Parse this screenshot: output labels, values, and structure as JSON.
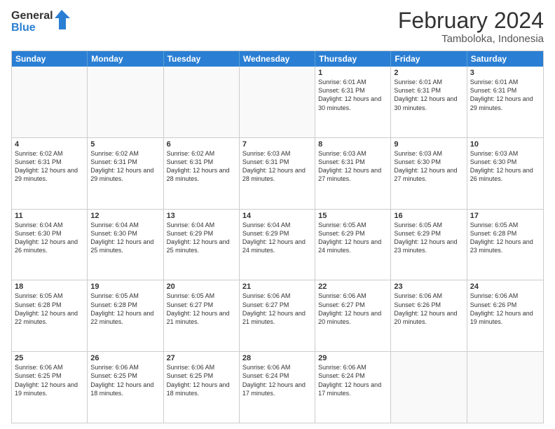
{
  "logo": {
    "line1": "General",
    "line2": "Blue"
  },
  "title": "February 2024",
  "subtitle": "Tamboloka, Indonesia",
  "header_days": [
    "Sunday",
    "Monday",
    "Tuesday",
    "Wednesday",
    "Thursday",
    "Friday",
    "Saturday"
  ],
  "weeks": [
    [
      {
        "day": "",
        "sunrise": "",
        "sunset": "",
        "daylight": ""
      },
      {
        "day": "",
        "sunrise": "",
        "sunset": "",
        "daylight": ""
      },
      {
        "day": "",
        "sunrise": "",
        "sunset": "",
        "daylight": ""
      },
      {
        "day": "",
        "sunrise": "",
        "sunset": "",
        "daylight": ""
      },
      {
        "day": "1",
        "sunrise": "Sunrise: 6:01 AM",
        "sunset": "Sunset: 6:31 PM",
        "daylight": "Daylight: 12 hours and 30 minutes."
      },
      {
        "day": "2",
        "sunrise": "Sunrise: 6:01 AM",
        "sunset": "Sunset: 6:31 PM",
        "daylight": "Daylight: 12 hours and 30 minutes."
      },
      {
        "day": "3",
        "sunrise": "Sunrise: 6:01 AM",
        "sunset": "Sunset: 6:31 PM",
        "daylight": "Daylight: 12 hours and 29 minutes."
      }
    ],
    [
      {
        "day": "4",
        "sunrise": "Sunrise: 6:02 AM",
        "sunset": "Sunset: 6:31 PM",
        "daylight": "Daylight: 12 hours and 29 minutes."
      },
      {
        "day": "5",
        "sunrise": "Sunrise: 6:02 AM",
        "sunset": "Sunset: 6:31 PM",
        "daylight": "Daylight: 12 hours and 29 minutes."
      },
      {
        "day": "6",
        "sunrise": "Sunrise: 6:02 AM",
        "sunset": "Sunset: 6:31 PM",
        "daylight": "Daylight: 12 hours and 28 minutes."
      },
      {
        "day": "7",
        "sunrise": "Sunrise: 6:03 AM",
        "sunset": "Sunset: 6:31 PM",
        "daylight": "Daylight: 12 hours and 28 minutes."
      },
      {
        "day": "8",
        "sunrise": "Sunrise: 6:03 AM",
        "sunset": "Sunset: 6:31 PM",
        "daylight": "Daylight: 12 hours and 27 minutes."
      },
      {
        "day": "9",
        "sunrise": "Sunrise: 6:03 AM",
        "sunset": "Sunset: 6:30 PM",
        "daylight": "Daylight: 12 hours and 27 minutes."
      },
      {
        "day": "10",
        "sunrise": "Sunrise: 6:03 AM",
        "sunset": "Sunset: 6:30 PM",
        "daylight": "Daylight: 12 hours and 26 minutes."
      }
    ],
    [
      {
        "day": "11",
        "sunrise": "Sunrise: 6:04 AM",
        "sunset": "Sunset: 6:30 PM",
        "daylight": "Daylight: 12 hours and 26 minutes."
      },
      {
        "day": "12",
        "sunrise": "Sunrise: 6:04 AM",
        "sunset": "Sunset: 6:30 PM",
        "daylight": "Daylight: 12 hours and 25 minutes."
      },
      {
        "day": "13",
        "sunrise": "Sunrise: 6:04 AM",
        "sunset": "Sunset: 6:29 PM",
        "daylight": "Daylight: 12 hours and 25 minutes."
      },
      {
        "day": "14",
        "sunrise": "Sunrise: 6:04 AM",
        "sunset": "Sunset: 6:29 PM",
        "daylight": "Daylight: 12 hours and 24 minutes."
      },
      {
        "day": "15",
        "sunrise": "Sunrise: 6:05 AM",
        "sunset": "Sunset: 6:29 PM",
        "daylight": "Daylight: 12 hours and 24 minutes."
      },
      {
        "day": "16",
        "sunrise": "Sunrise: 6:05 AM",
        "sunset": "Sunset: 6:29 PM",
        "daylight": "Daylight: 12 hours and 23 minutes."
      },
      {
        "day": "17",
        "sunrise": "Sunrise: 6:05 AM",
        "sunset": "Sunset: 6:28 PM",
        "daylight": "Daylight: 12 hours and 23 minutes."
      }
    ],
    [
      {
        "day": "18",
        "sunrise": "Sunrise: 6:05 AM",
        "sunset": "Sunset: 6:28 PM",
        "daylight": "Daylight: 12 hours and 22 minutes."
      },
      {
        "day": "19",
        "sunrise": "Sunrise: 6:05 AM",
        "sunset": "Sunset: 6:28 PM",
        "daylight": "Daylight: 12 hours and 22 minutes."
      },
      {
        "day": "20",
        "sunrise": "Sunrise: 6:05 AM",
        "sunset": "Sunset: 6:27 PM",
        "daylight": "Daylight: 12 hours and 21 minutes."
      },
      {
        "day": "21",
        "sunrise": "Sunrise: 6:06 AM",
        "sunset": "Sunset: 6:27 PM",
        "daylight": "Daylight: 12 hours and 21 minutes."
      },
      {
        "day": "22",
        "sunrise": "Sunrise: 6:06 AM",
        "sunset": "Sunset: 6:27 PM",
        "daylight": "Daylight: 12 hours and 20 minutes."
      },
      {
        "day": "23",
        "sunrise": "Sunrise: 6:06 AM",
        "sunset": "Sunset: 6:26 PM",
        "daylight": "Daylight: 12 hours and 20 minutes."
      },
      {
        "day": "24",
        "sunrise": "Sunrise: 6:06 AM",
        "sunset": "Sunset: 6:26 PM",
        "daylight": "Daylight: 12 hours and 19 minutes."
      }
    ],
    [
      {
        "day": "25",
        "sunrise": "Sunrise: 6:06 AM",
        "sunset": "Sunset: 6:25 PM",
        "daylight": "Daylight: 12 hours and 19 minutes."
      },
      {
        "day": "26",
        "sunrise": "Sunrise: 6:06 AM",
        "sunset": "Sunset: 6:25 PM",
        "daylight": "Daylight: 12 hours and 18 minutes."
      },
      {
        "day": "27",
        "sunrise": "Sunrise: 6:06 AM",
        "sunset": "Sunset: 6:25 PM",
        "daylight": "Daylight: 12 hours and 18 minutes."
      },
      {
        "day": "28",
        "sunrise": "Sunrise: 6:06 AM",
        "sunset": "Sunset: 6:24 PM",
        "daylight": "Daylight: 12 hours and 17 minutes."
      },
      {
        "day": "29",
        "sunrise": "Sunrise: 6:06 AM",
        "sunset": "Sunset: 6:24 PM",
        "daylight": "Daylight: 12 hours and 17 minutes."
      },
      {
        "day": "",
        "sunrise": "",
        "sunset": "",
        "daylight": ""
      },
      {
        "day": "",
        "sunrise": "",
        "sunset": "",
        "daylight": ""
      }
    ]
  ]
}
